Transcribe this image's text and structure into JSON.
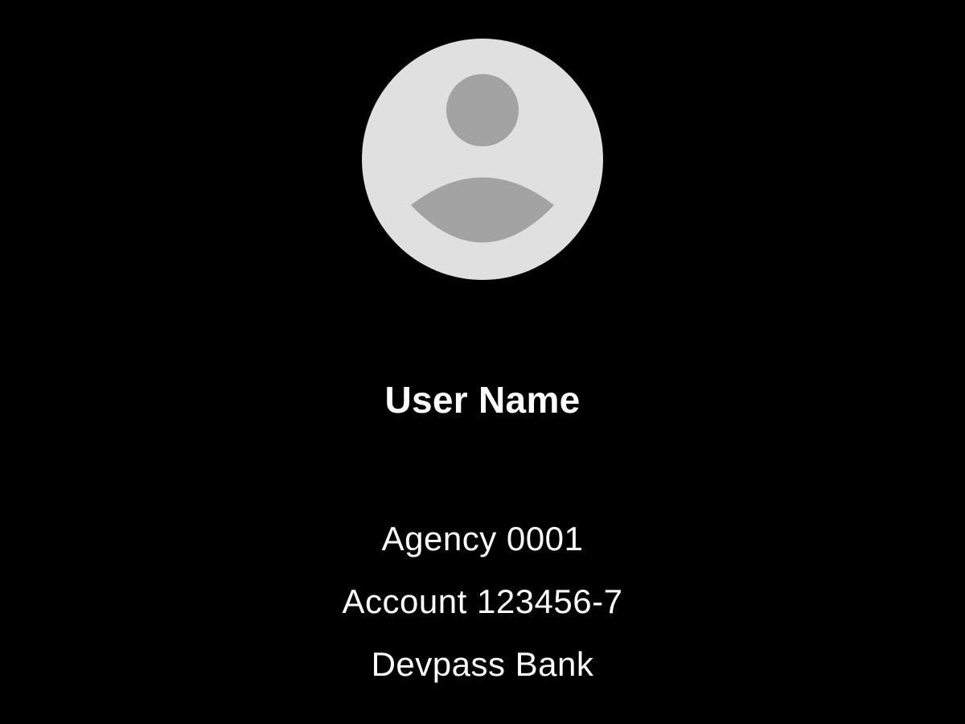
{
  "profile": {
    "avatar_icon": "user-silhouette-icon",
    "user_name": "User Name",
    "agency": "Agency 0001",
    "account": "Account 123456-7",
    "bank": "Devpass Bank"
  },
  "colors": {
    "background": "#000000",
    "avatar_circle": "#e0e0e0",
    "avatar_figure": "#a3a3a3",
    "text": "#ffffff"
  }
}
